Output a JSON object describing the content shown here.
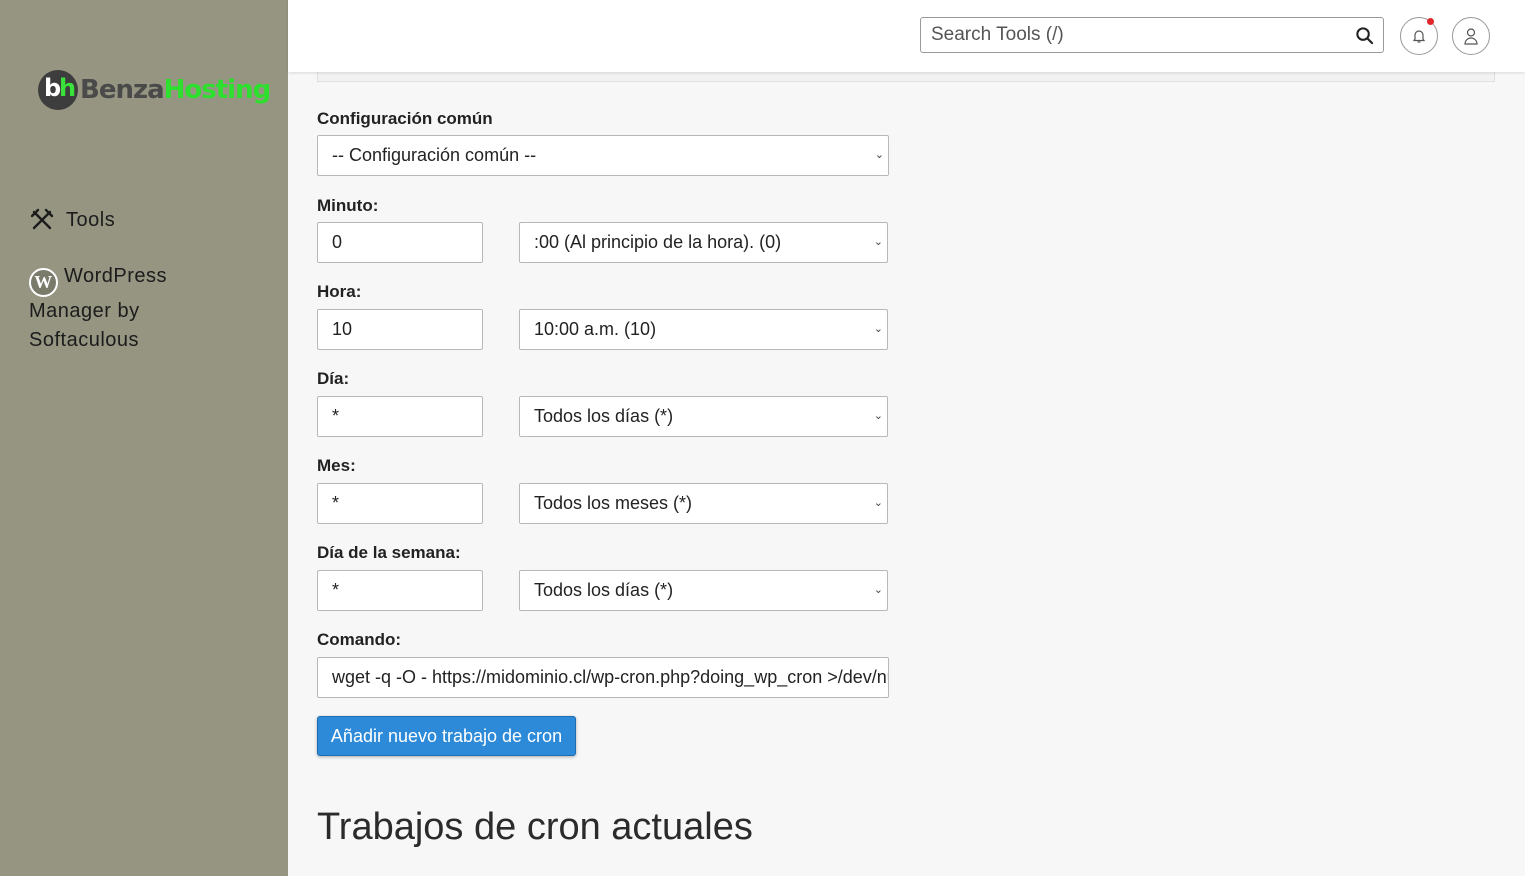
{
  "brand": {
    "mark_b": "b",
    "mark_h": "h",
    "word1": "Benza",
    "word2": "Hosting"
  },
  "sidebar": {
    "tools": "Tools",
    "wordpress": "WordPress Manager by Softaculous"
  },
  "header": {
    "search_placeholder": "Search Tools (/)"
  },
  "form": {
    "common": {
      "label": "Configuración común",
      "value": "-- Configuración común --"
    },
    "minute": {
      "label": "Minuto:",
      "input": "0",
      "select": ":00 (Al principio de la hora). (0)"
    },
    "hour": {
      "label": "Hora:",
      "input": "10",
      "select": "10:00 a.m. (10)"
    },
    "day": {
      "label": "Día:",
      "input": "*",
      "select": "Todos los días (*)"
    },
    "month": {
      "label": "Mes:",
      "input": "*",
      "select": "Todos los meses (*)"
    },
    "weekday": {
      "label": "Día de la semana:",
      "input": "*",
      "select": "Todos los días (*)"
    },
    "command": {
      "label": "Comando:",
      "value": "wget -q -O - https://midominio.cl/wp-cron.php?doing_wp_cron >/dev/null"
    },
    "submit": "Añadir nuevo trabajo de cron"
  },
  "section_title": "Trabajos de cron actuales",
  "colors": {
    "sidebar_bg": "#959582",
    "button": "#2c8ad8",
    "notification_dot": "#e0262a",
    "brand_green": "#2ee02e"
  }
}
